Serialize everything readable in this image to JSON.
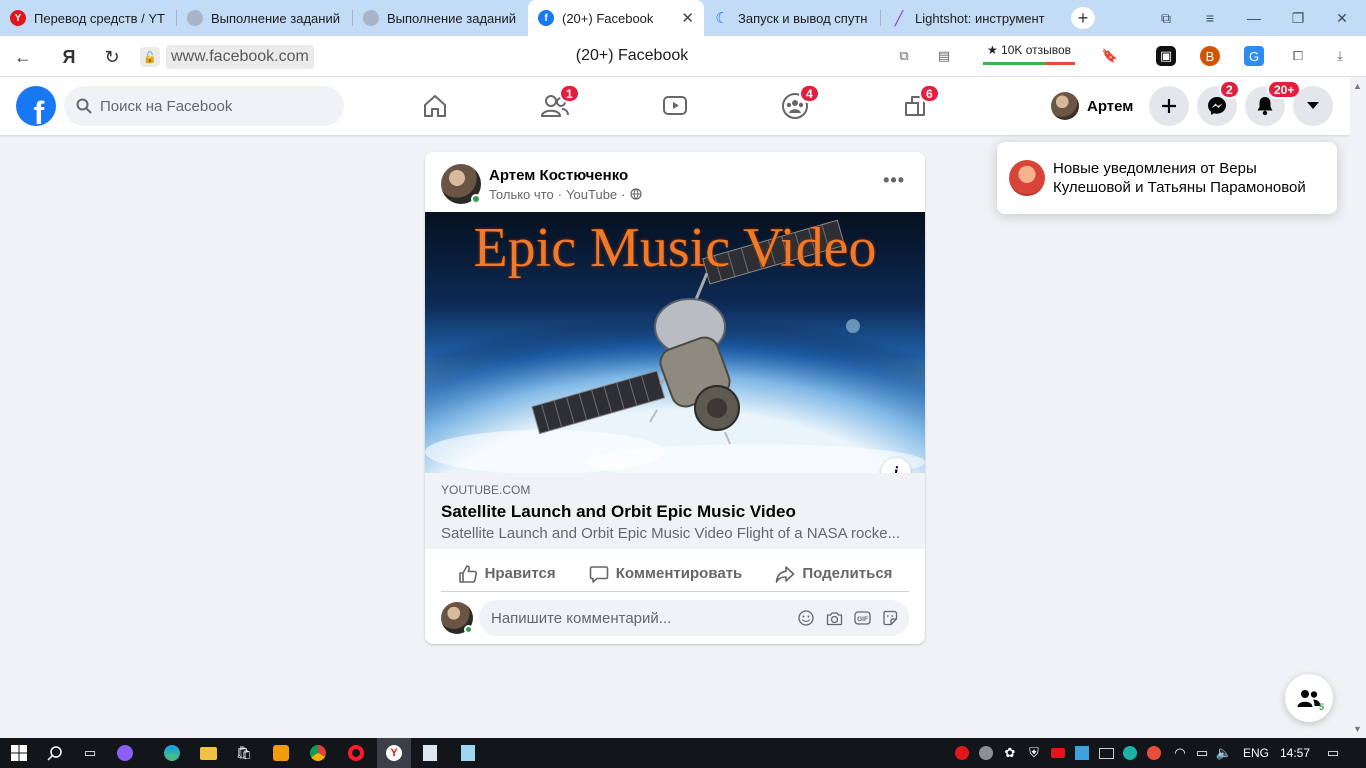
{
  "browser": {
    "tabs": [
      {
        "label": "Перевод средств / YT",
        "favicon": "yandex-icon"
      },
      {
        "label": "Выполнение заданий",
        "favicon": "globe-icon"
      },
      {
        "label": "Выполнение заданий",
        "favicon": "globe-icon"
      },
      {
        "label": "(20+) Facebook",
        "favicon": "facebook-icon",
        "active": true
      },
      {
        "label": "Запуск и вывод спутн",
        "favicon": "moon-icon"
      },
      {
        "label": "Lightshot: инструмент",
        "favicon": "pen-icon"
      }
    ],
    "url": "www.facebook.com",
    "page_title": "(20+) Facebook",
    "reviews": "★ 10K отзывов"
  },
  "fb": {
    "logo": "f",
    "search_placeholder": "Поиск на Facebook",
    "nav_badges": {
      "friends": "1",
      "groups": "4",
      "gaming": "6"
    },
    "profile_name": "Артем",
    "messenger_badge": "2",
    "notifications_badge": "20+"
  },
  "notification_popup": {
    "text": "Новые уведомления от Веры Кулешовой и Татьяны Парамоновой"
  },
  "post": {
    "author": "Артем Костюченко",
    "time": "Только что",
    "source": "YouTube",
    "thumbnail_title": "Epic Music Video",
    "link_domain": "YOUTUBE.COM",
    "link_title": "Satellite Launch and Orbit Epic Music Video",
    "link_description": "Satellite Launch and Orbit Epic Music Video Flight of a NASA rocke...",
    "actions": {
      "like": "Нравится",
      "comment": "Комментировать",
      "share": "Поделиться"
    },
    "comment_placeholder": "Напишите комментарий..."
  },
  "contacts_count": "5",
  "taskbar": {
    "lang": "ENG",
    "time": "14:57"
  }
}
